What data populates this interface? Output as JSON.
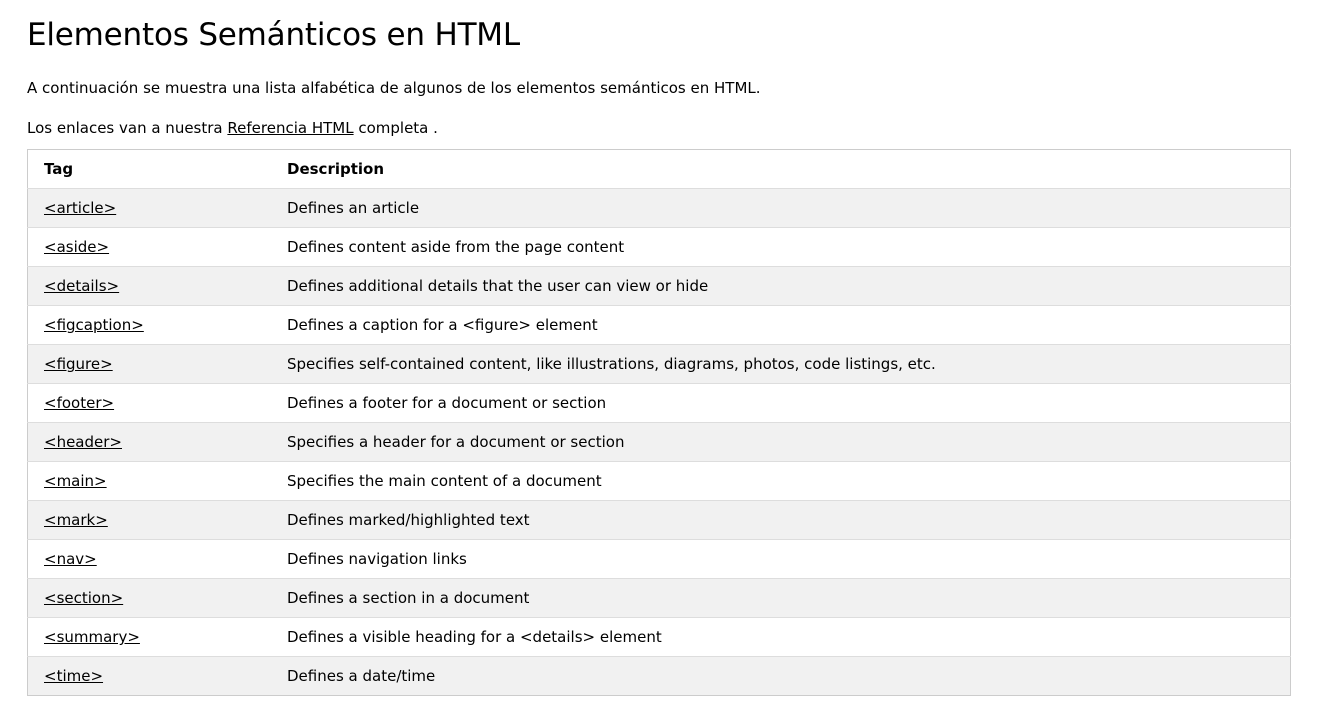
{
  "page": {
    "title": "Elementos Semánticos en HTML",
    "intro": "A continuación se muestra una lista alfabética de algunos de los elementos semánticos en HTML.",
    "links_note_before": "Los enlaces van a nuestra ",
    "links_note_link": "Referencia HTML",
    "links_note_after": " completa ."
  },
  "table": {
    "headers": [
      "Tag",
      "Description"
    ],
    "rows": [
      {
        "tag": "<article>",
        "description": "Defines an article"
      },
      {
        "tag": "<aside>",
        "description": "Defines content aside from the page content"
      },
      {
        "tag": "<details>",
        "description": "Defines additional details that the user can view or hide"
      },
      {
        "tag": "<figcaption>",
        "description": "Defines a caption for a <figure> element"
      },
      {
        "tag": "<figure>",
        "description": "Specifies self-contained content, like illustrations, diagrams, photos, code listings, etc."
      },
      {
        "tag": "<footer>",
        "description": "Defines a footer for a document or section"
      },
      {
        "tag": "<header>",
        "description": "Specifies a header for a document or section"
      },
      {
        "tag": "<main>",
        "description": "Specifies the main content of a document"
      },
      {
        "tag": "<mark>",
        "description": "Defines marked/highlighted text"
      },
      {
        "tag": "<nav>",
        "description": "Defines navigation links"
      },
      {
        "tag": "<section>",
        "description": "Defines a section in a document"
      },
      {
        "tag": "<summary>",
        "description": "Defines a visible heading for a <details> element"
      },
      {
        "tag": "<time>",
        "description": "Defines a date/time"
      }
    ]
  }
}
